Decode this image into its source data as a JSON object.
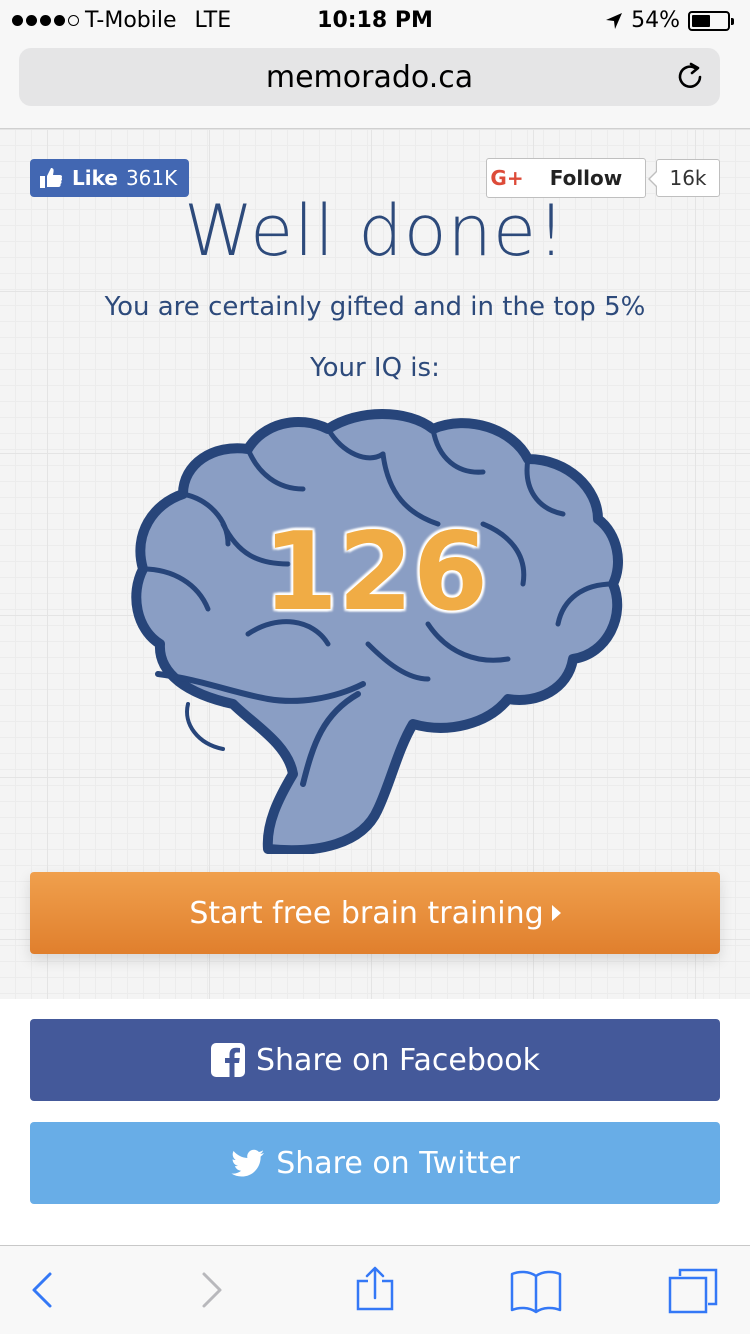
{
  "status": {
    "carrier": "T-Mobile",
    "network": "LTE",
    "time": "10:18 PM",
    "battery": "54%",
    "battery_level": 0.54
  },
  "browser": {
    "url": "memorado.ca"
  },
  "social": {
    "fb_like_label": "Like",
    "fb_like_count": "361K",
    "gplus_icon": "G+",
    "gplus_follow_label": "Follow",
    "gplus_count": "16k"
  },
  "result": {
    "headline": "Well done!",
    "subline": "You are certainly gifted and in the top 5%",
    "iq_label": "Your IQ is:",
    "iq_score": "126"
  },
  "actions": {
    "train_label": "Start free brain training",
    "facebook_label": "Share on Facebook",
    "twitter_label": "Share on Twitter"
  },
  "colors": {
    "brand_blue": "#2d4a7b",
    "score_orange": "#f0ac45",
    "train_orange": "#e8913c",
    "facebook": "#44599a",
    "twitter": "#68ade7",
    "ios_blue": "#3478f6"
  },
  "icons": [
    "thumbs-up-icon",
    "google-plus-icon",
    "brain-icon",
    "reload-icon",
    "facebook-icon",
    "twitter-icon",
    "back-icon",
    "forward-icon",
    "share-icon",
    "bookmarks-icon",
    "tabs-icon"
  ]
}
